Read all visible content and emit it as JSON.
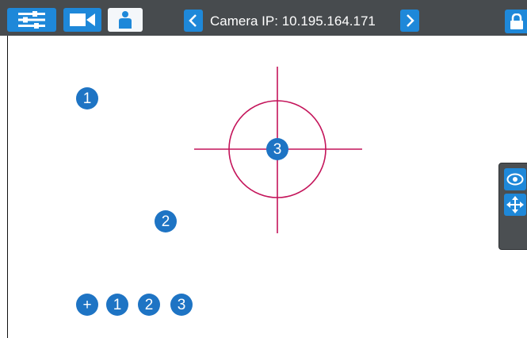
{
  "toolbar": {
    "settings_icon": "sliders-icon",
    "camera_icon": "video-camera-icon",
    "user_icon": "user-icon",
    "lock_icon": "lock-icon"
  },
  "camera": {
    "prev_label": "<",
    "title": "Camera IP: 10.195.164.171",
    "next_label": ">"
  },
  "markers": [
    "1",
    "2",
    "3"
  ],
  "preset_bar": {
    "add_label": "+",
    "presets": [
      "1",
      "2",
      "3"
    ]
  },
  "side_panel": {
    "view_icon": "eye-icon",
    "move_icon": "move-arrows-icon"
  },
  "colors": {
    "toolbar_bg": "#474b4e",
    "accent": "#1e88d9",
    "marker": "#1e74c4",
    "crosshair": "#c4145a"
  }
}
